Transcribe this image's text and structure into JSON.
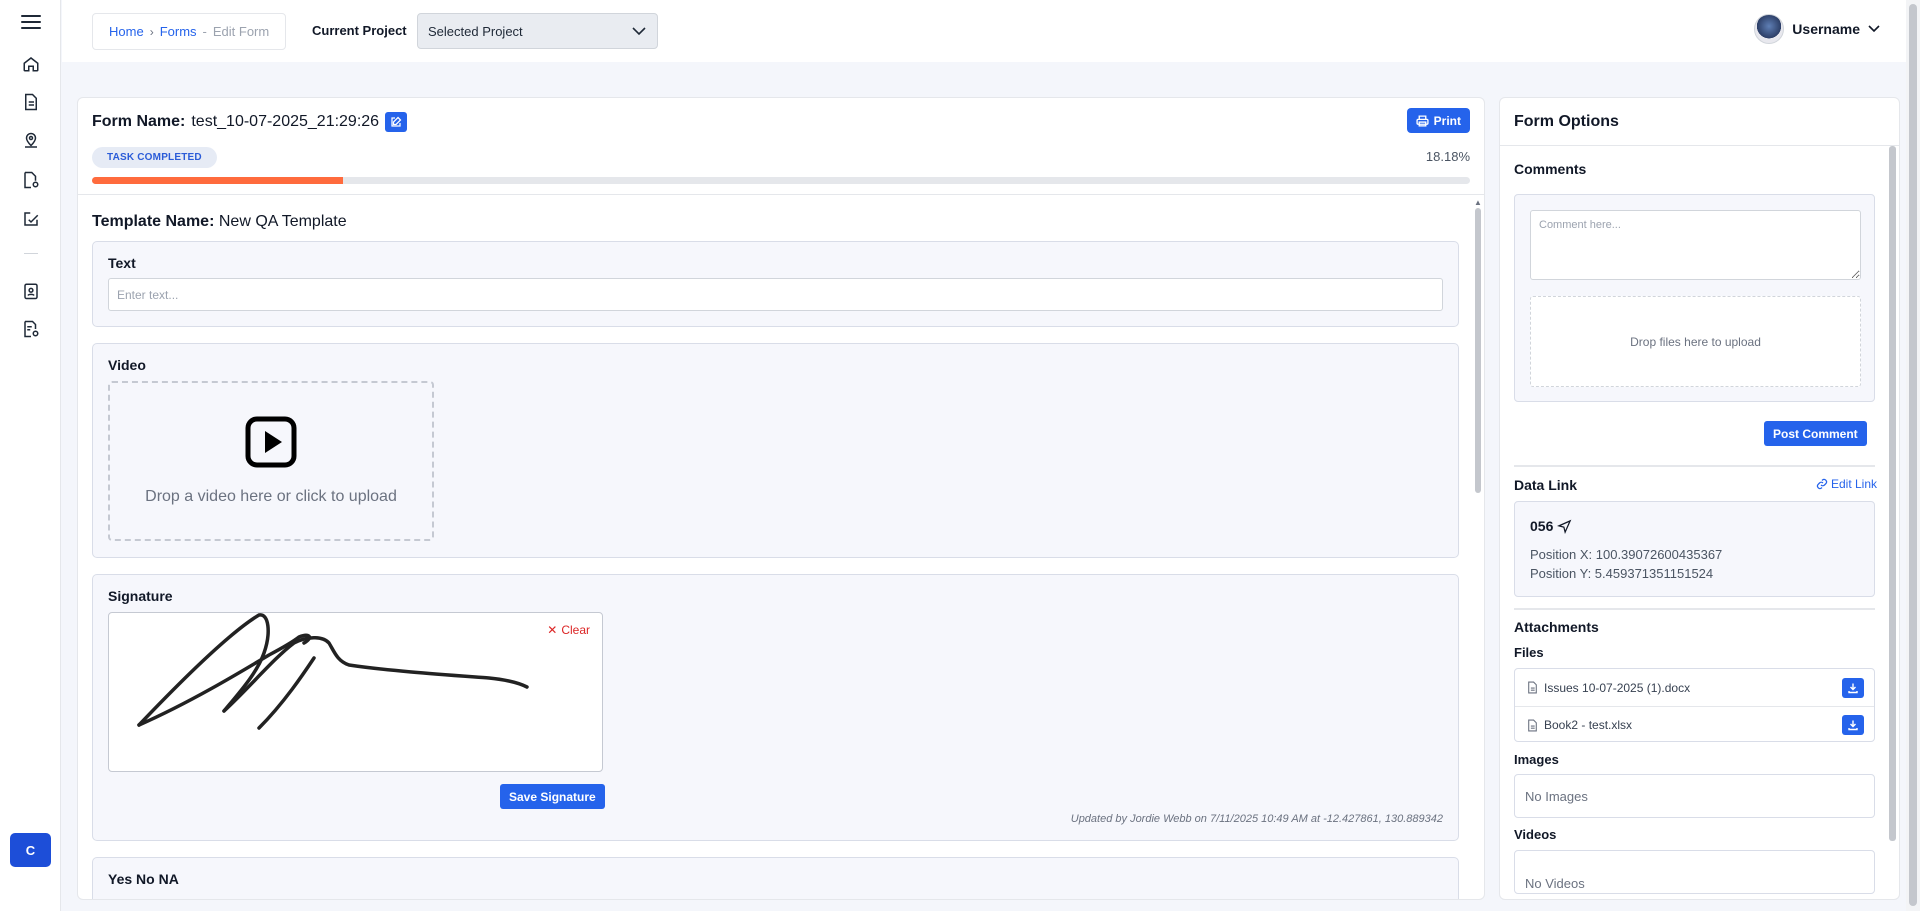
{
  "breadcrumb": {
    "home": "Home",
    "forms": "Forms",
    "separator": "-",
    "current": "Edit Form"
  },
  "project": {
    "label": "Current Project",
    "selected": "Selected Project"
  },
  "user": {
    "name": "Username"
  },
  "sidebar": {
    "items": [
      {
        "icon": "home-icon"
      },
      {
        "icon": "document-icon"
      },
      {
        "icon": "map-pin-icon"
      },
      {
        "icon": "report-icon"
      },
      {
        "icon": "edit-check-icon"
      },
      {
        "icon": "clipboard-user-icon"
      },
      {
        "icon": "settings-list-icon"
      }
    ],
    "avatar_initial": "C"
  },
  "form": {
    "name_label": "Form Name:",
    "name_value": "test_10-07-2025_21:29:26",
    "print_label": "Print",
    "status": "TASK COMPLETED",
    "progress_text": "18.18%",
    "progress_value": 18.18,
    "template_label": "Template Name:",
    "template_value": "New QA Template"
  },
  "fields": {
    "text": {
      "label": "Text",
      "placeholder": "Enter text..."
    },
    "video": {
      "label": "Video",
      "drop_text": "Drop a video here or click to upload"
    },
    "signature": {
      "label": "Signature",
      "clear_label": "Clear",
      "save_label": "Save Signature",
      "updated": "Updated by Jordie Webb on 7/11/2025 10:49 AM at -12.427861, 130.889342"
    },
    "yes_no_na": {
      "label": "Yes No NA"
    }
  },
  "options": {
    "title": "Form Options",
    "comments": {
      "label": "Comments",
      "placeholder": "Comment here...",
      "drop_text": "Drop files here to upload",
      "post_label": "Post Comment"
    },
    "data_link": {
      "label": "Data Link",
      "edit_label": "Edit Link",
      "id": "056",
      "pos_x": "Position X: 100.39072600435367",
      "pos_y": "Position Y: 5.459371351151524"
    },
    "attachments": {
      "label": "Attachments",
      "files_label": "Files",
      "files": [
        "Issues 10-07-2025 (1).docx",
        "Book2 - test.xlsx"
      ],
      "images_label": "Images",
      "images_empty": "No Images",
      "videos_label": "Videos",
      "videos_empty": "No Videos"
    }
  },
  "colors": {
    "accent": "#2563eb",
    "progress": "#ff6b3d",
    "danger": "#dc2626"
  }
}
